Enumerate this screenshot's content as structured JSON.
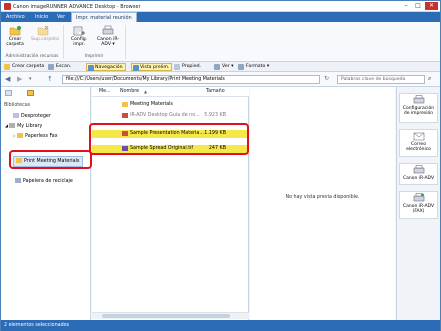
{
  "window": {
    "title": "Canon imageRUNNER ADVANCE Desktop - Browser",
    "controls": [
      "–",
      "□",
      "✕"
    ]
  },
  "menu": {
    "tabs": [
      "Archivo",
      "Inicio",
      "Ver",
      "Impr. material reunión"
    ],
    "active_index": 3
  },
  "ribbon": {
    "buttons": [
      {
        "label": "Crear carpeta",
        "icon": "folder-new-icon"
      },
      {
        "label": "Sup.carpeta",
        "icon": "folder-delete-icon"
      },
      {
        "label": "Config. impr.",
        "icon": "print-settings-icon"
      },
      {
        "label": "Canon iR-ADV ▾",
        "icon": "printer-icon"
      }
    ],
    "groups": [
      "Administración recursos",
      "Imprimir"
    ]
  },
  "toolbar": {
    "items": [
      {
        "label": "Crear carpeta",
        "icon": "folder-new-icon",
        "selected": false
      },
      {
        "label": "Escan.",
        "icon": "scan-icon",
        "selected": false
      },
      {
        "label": "Navegación",
        "icon": "navigation-icon",
        "selected": true
      },
      {
        "label": "Vista prelim.",
        "icon": "preview-icon",
        "selected": true
      },
      {
        "label": "Propied.",
        "icon": "properties-icon",
        "selected": false
      },
      {
        "label": "Ver ▾",
        "icon": "view-icon",
        "selected": false
      },
      {
        "label": "Formato ▾",
        "icon": "format-icon",
        "selected": false
      }
    ]
  },
  "address": {
    "path": "file:///C:/Users/user/Documents/My Library/Print Meeting Materials",
    "search_placeholder": "Palabras clave de búsqueda"
  },
  "left": {
    "header": "Bibliotecas",
    "items": [
      {
        "label": "Desproteger"
      },
      {
        "label": "My Library"
      },
      {
        "label": "Paperless Fax"
      },
      {
        "label": "Print Meeting Materials"
      },
      {
        "label": "Papelera de reciclaje"
      }
    ]
  },
  "center": {
    "columns": [
      "Me...",
      "Nombre",
      "Tamaño"
    ],
    "rows": [
      {
        "name": "Meeting Materials",
        "size": "",
        "icon": "folder-icon",
        "selected": false
      },
      {
        "name": "iR-ADV Desktop Guía de no...",
        "size": "5.923 KB",
        "icon": "file-icon",
        "selected": false
      },
      {
        "name": "Sample Presentation Materia...",
        "size": "1.199 KB",
        "icon": "presentation-icon",
        "selected": true
      },
      {
        "name": "Sample Spread Original.tif",
        "size": "247 KB",
        "icon": "image-icon",
        "selected": true
      }
    ]
  },
  "preview": {
    "message": "No hay vista previa disponible."
  },
  "right_panel": {
    "items": [
      {
        "label": "Configuración de impresión",
        "icon": "print-settings-icon"
      },
      {
        "label": "Correo electrónico",
        "icon": "email-icon"
      },
      {
        "label": "Canon iR-ADV",
        "icon": "printer-icon"
      },
      {
        "label": "Canon iR-ADV (FAX)",
        "icon": "fax-icon"
      }
    ]
  },
  "status": {
    "text": "2 elementos seleccionados"
  },
  "colors": {
    "accent": "#2c6bb5",
    "highlight": "#e01020",
    "selection": "#f7e84a"
  }
}
